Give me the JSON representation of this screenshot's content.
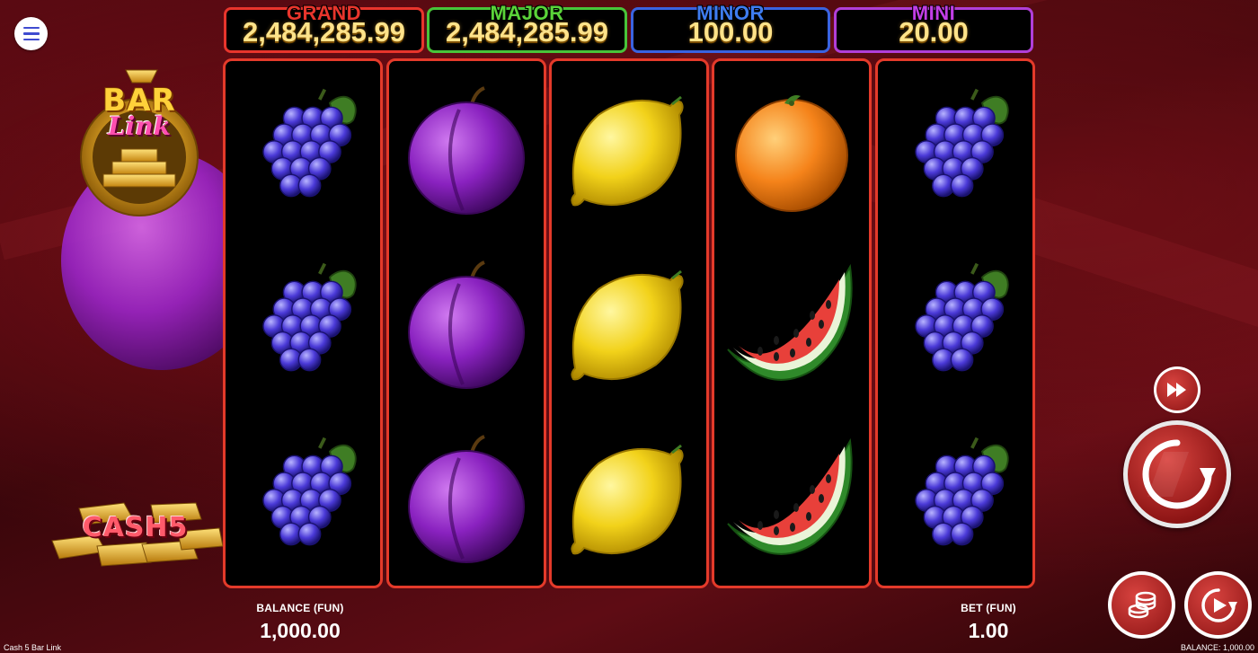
{
  "jackpots": [
    {
      "label": "GRAND",
      "value": "2,484,285.99",
      "label_color": "#e8352c",
      "border_color": "#e8352c"
    },
    {
      "label": "MAJOR",
      "value": "2,484,285.99",
      "label_color": "#5ad339",
      "border_color": "#48c43a"
    },
    {
      "label": "MINOR",
      "value": "100.00",
      "label_color": "#3e7cf0",
      "border_color": "#3a63e0"
    },
    {
      "label": "MINI",
      "value": "20.00",
      "label_color": "#c23ee6",
      "border_color": "#b13fd8"
    }
  ],
  "reels": [
    {
      "symbols": [
        "grapes",
        "grapes",
        "grapes"
      ]
    },
    {
      "symbols": [
        "plum",
        "plum",
        "plum"
      ]
    },
    {
      "symbols": [
        "lemon",
        "lemon",
        "lemon"
      ]
    },
    {
      "symbols": [
        "orange",
        "watermelon",
        "watermelon"
      ]
    },
    {
      "symbols": [
        "grapes",
        "grapes",
        "grapes"
      ]
    }
  ],
  "logos": {
    "bar_link_line1": "BAR",
    "bar_link_line2": "Link",
    "cash5": "CASH5"
  },
  "balance": {
    "label": "BALANCE (FUN)",
    "value": "1,000.00"
  },
  "bet": {
    "label": "BET (FUN)",
    "value": "1.00"
  },
  "footer": {
    "game_title": "Cash 5 Bar Link",
    "balance_text": "BALANCE: 1,000.00"
  },
  "icons": {
    "menu": "menu-icon",
    "turbo": "fast-forward-icon",
    "spin": "spin-arrow-icon",
    "bet": "coin-stack-icon",
    "autoplay": "autoplay-icon"
  },
  "colors": {
    "reel_border": "#e43a2a",
    "jackpot_value": "#ffe38a",
    "accent_red": "#c7302b"
  }
}
